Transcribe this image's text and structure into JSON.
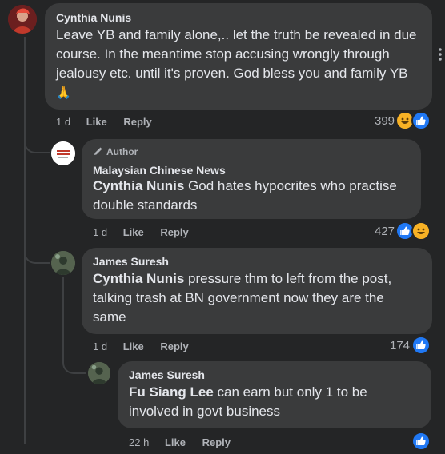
{
  "comments": [
    {
      "author": "Cynthia Nunis",
      "text": "Leave YB and family alone,.. let the truth be revealed in due course. In the meantime stop accusing wrongly through jealousy etc. until it's proven. God bless you and family YB",
      "emoji": "🙏",
      "time": "1 d",
      "like_label": "Like",
      "reply_label": "Reply",
      "reaction_count": "399"
    },
    {
      "badge": "Author",
      "author": "Malaysian Chinese News",
      "mention": "Cynthia Nunis",
      "text": " God hates hypocrites who practise double standards",
      "time": "1 d",
      "like_label": "Like",
      "reply_label": "Reply",
      "reaction_count": "427"
    },
    {
      "author": "James Suresh",
      "mention": "Cynthia Nunis",
      "text": " pressure thm to left from the post, talking trash at BN government now they are the same",
      "time": "1 d",
      "like_label": "Like",
      "reply_label": "Reply",
      "reaction_count": "174"
    },
    {
      "author": "James Suresh",
      "mention": "Fu Siang Lee",
      "text": " can earn but only 1 to be involved in govt business",
      "time": "22 h",
      "like_label": "Like",
      "reply_label": "Reply"
    }
  ],
  "colors": {
    "background": "#242526",
    "bubble": "#3a3b3c",
    "like_blue": "#2078f4",
    "laugh_yellow": "#f7b125"
  },
  "icons": [
    "pencil-icon",
    "like-reaction-icon",
    "haha-reaction-icon",
    "more-options-icon"
  ]
}
